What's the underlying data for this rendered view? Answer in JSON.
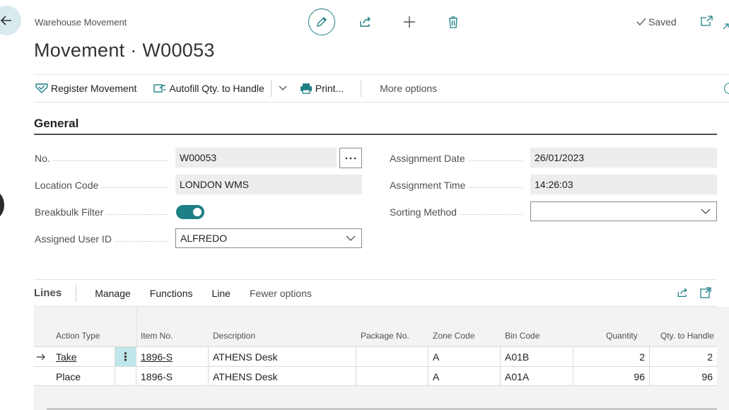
{
  "header": {
    "breadcrumb": "Warehouse Movement",
    "title": "Movement · W00053",
    "status": "Saved"
  },
  "actions": {
    "register": "Register Movement",
    "autofill": "Autofill Qty. to Handle",
    "print": "Print...",
    "more": "More options"
  },
  "general": {
    "title": "General",
    "no_label": "No.",
    "no_value": "W00053",
    "location_label": "Location Code",
    "location_value": "LONDON WMS",
    "breakbulk_label": "Breakbulk Filter",
    "breakbulk_on": true,
    "user_label": "Assigned User ID",
    "user_value": "ALFREDO",
    "date_label": "Assignment Date",
    "date_value": "26/01/2023",
    "time_label": "Assignment Time",
    "time_value": "14:26:03",
    "sorting_label": "Sorting Method",
    "sorting_value": ""
  },
  "lines": {
    "title": "Lines",
    "manage": "Manage",
    "functions": "Functions",
    "line": "Line",
    "fewer": "Fewer options",
    "columns": {
      "action_type": "Action Type",
      "item_no": "Item No.",
      "description": "Description",
      "package_no": "Package No.",
      "zone_code": "Zone Code",
      "bin_code": "Bin Code",
      "quantity": "Quantity",
      "qty_to_handle": "Qty. to Handle"
    },
    "rows": [
      {
        "action_type": "Take",
        "item_no": "1896-S",
        "description": "ATHENS Desk",
        "package_no": "",
        "zone_code": "A",
        "bin_code": "A01B",
        "quantity": "2",
        "qty_to_handle": "2"
      },
      {
        "action_type": "Place",
        "item_no": "1896-S",
        "description": "ATHENS Desk",
        "package_no": "",
        "zone_code": "A",
        "bin_code": "A01A",
        "quantity": "96",
        "qty_to_handle": "96"
      }
    ]
  },
  "colors": {
    "accent": "#1f7f86",
    "row_menu": "#bfe6ea"
  }
}
